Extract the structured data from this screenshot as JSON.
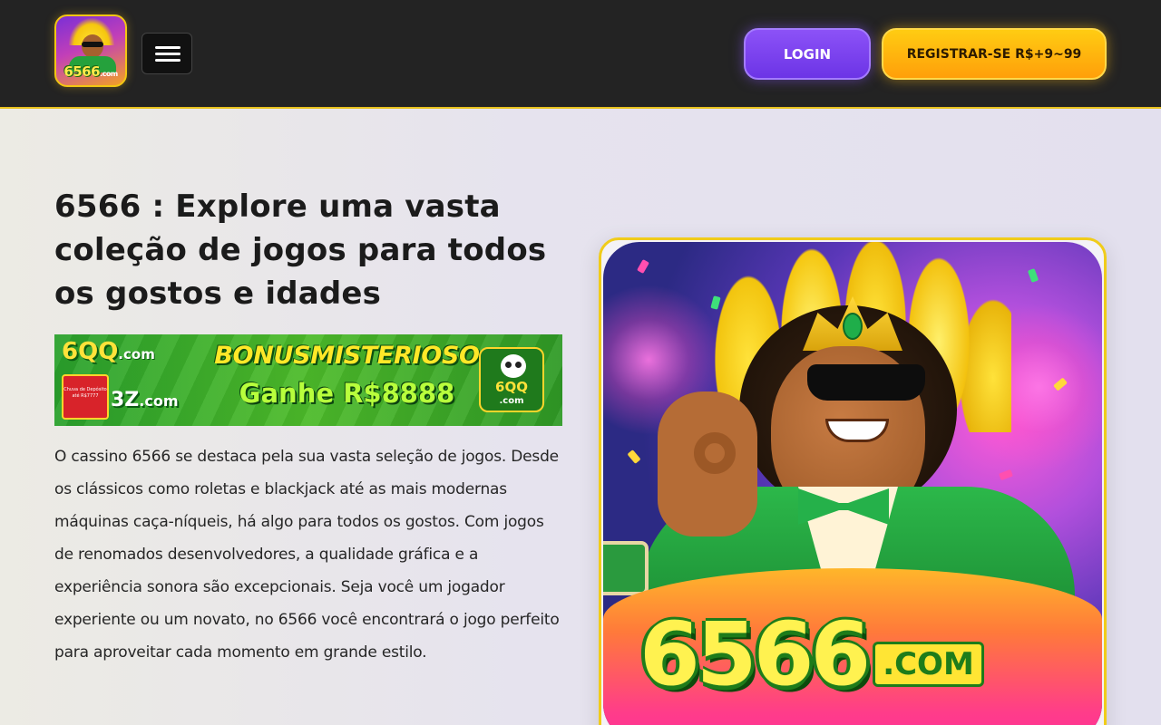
{
  "header": {
    "logo": {
      "text": "6566",
      "suffix": ".com"
    },
    "menu_icon": "hamburger-menu-icon",
    "login_label": "LOGIN",
    "register_label": "REGISTRAR-SE R$+9~99",
    "colors": {
      "background": "#232323",
      "accent": "#e8c21e",
      "login": "#7b41ef",
      "register": "#ffb40e"
    }
  },
  "main": {
    "title": "6566 : Explore uma vasta coleção de jogos para todos os gostos e idades",
    "banner": {
      "brand_top": "6QQ",
      "brand_top_suffix": ".com",
      "brand_bottom": "3Z",
      "brand_bottom_suffix": ".com",
      "gift_text": "Chuva de Depósito até R$7777",
      "headline": "BONUSMISTERIOSO",
      "subline": "Ganhe R$8888",
      "badge_brand": "6QQ",
      "badge_suffix": ".com"
    },
    "description": "O cassino 6566 se destaca pela sua vasta seleção de jogos. Desde os clássicos como roletas e blackjack até as mais modernas máquinas caça-níqueis, há algo para todos os gostos. Com jogos de renomados desenvolvedores, a qualidade gráfica e a experiência sonora são excepcionais. Seja você um jogador experiente ou um novato, no 6566 você encontrará o jogo perfeito para aproveitar cada momento em grande estilo.",
    "hero": {
      "logo_number": "6566",
      "logo_domain": ".COM"
    }
  }
}
